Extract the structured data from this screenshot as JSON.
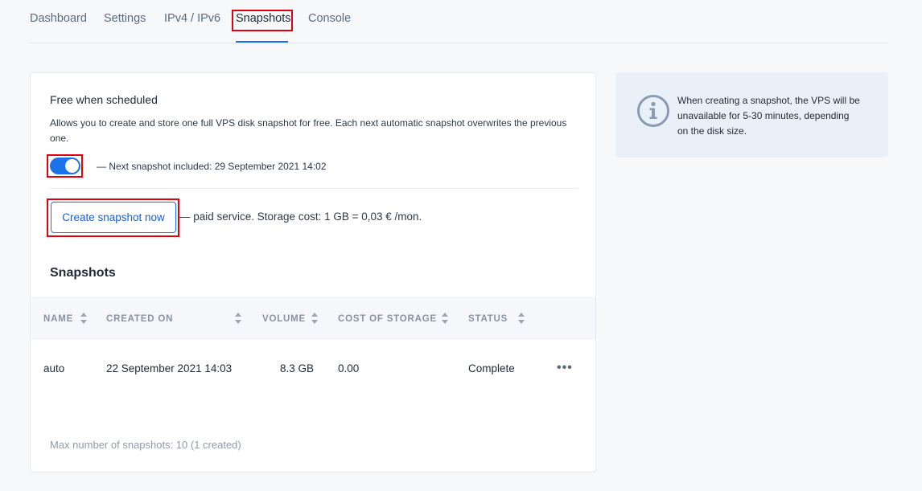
{
  "tabs": [
    {
      "label": "Dashboard"
    },
    {
      "label": "Settings"
    },
    {
      "label": "IPv4 / IPv6"
    },
    {
      "label": "Snapshots",
      "active": true
    },
    {
      "label": "Console"
    }
  ],
  "card": {
    "title": "Free when scheduled",
    "description": "Allows you to create and store one full VPS disk snapshot for free. Each next automatic snapshot overwrites the previous one.",
    "toggle_on": true,
    "next_snapshot": "— Next snapshot included: 29 September 2021 14:02",
    "create_button": "Create snapshot now",
    "paid_note": "— paid service. Storage cost: 1 GB = 0,03 € /mon.",
    "section_title": "Snapshots"
  },
  "table": {
    "columns": [
      "NAME",
      "CREATED ON",
      "VOLUME",
      "COST OF STORAGE",
      "STATUS"
    ],
    "rows": [
      {
        "name": "auto",
        "created_on": "22 September 2021 14:03",
        "volume": "8.3 GB",
        "cost": "0.00",
        "status": "Complete"
      }
    ],
    "more_label": "•••"
  },
  "max_note": "Max number of snapshots: 10 (1 created)",
  "info": {
    "text": "When creating a snapshot, the VPS will be unavailable for 5-30 minutes, depending on the disk size."
  },
  "colors": {
    "accent": "#1a73e8",
    "highlight": "#e1000f",
    "info_bg": "#eaf0f8"
  }
}
